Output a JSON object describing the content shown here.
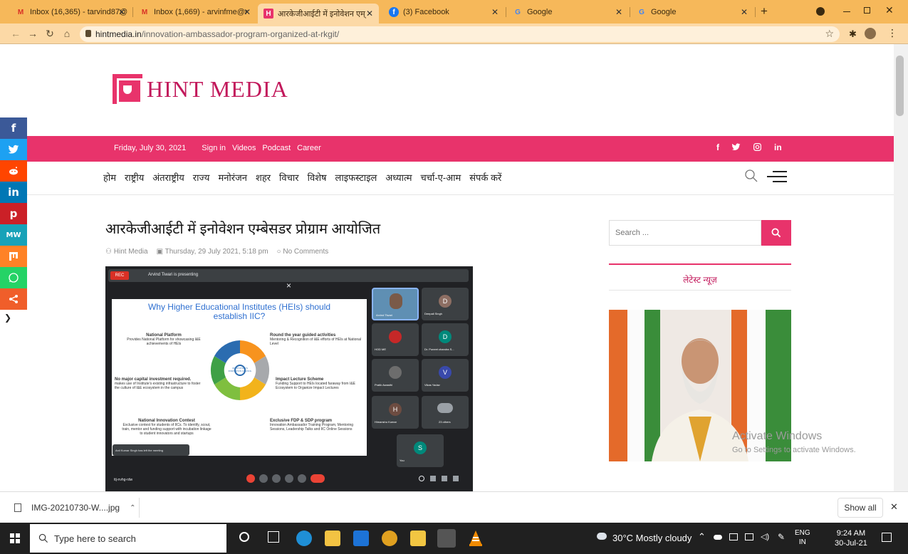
{
  "browser": {
    "tabs": [
      {
        "label": "Inbox (16,365) - tarvind87@",
        "icon": "gmail-icon"
      },
      {
        "label": "Inbox (1,669) - arvinfme@r",
        "icon": "gmail-icon"
      },
      {
        "label": "आरकेजीआईटी में इनोवेशन एम्",
        "icon": "hintmedia-icon",
        "active": true
      },
      {
        "label": "(3) Facebook",
        "icon": "facebook-icon"
      },
      {
        "label": "Google",
        "icon": "google-icon"
      },
      {
        "label": "Google",
        "icon": "google-icon"
      }
    ],
    "new_tab_symbol": "+",
    "url_host": "hintmedia.in",
    "url_path": "/innovation-ambassador-program-organized-at-rkgit/",
    "accent": "#f6b85a"
  },
  "site": {
    "logo_text": "HINT MEDIA",
    "brand_color": "#e8336b",
    "date": "Friday, July 30, 2021",
    "top_links": [
      "Sign in",
      "Videos",
      "Podcast",
      "Career"
    ],
    "social_top": [
      "f",
      "in"
    ],
    "menu": [
      "होम",
      "राष्ट्रीय",
      "अंतराष्ट्रीय",
      "राज्य",
      "मनोरंजन",
      "शहर",
      "विचार",
      "विशेष",
      "लाइफस्टाइल",
      "अध्यात्म",
      "चर्चा-ए-आम",
      "संपर्क करें"
    ]
  },
  "article": {
    "title": "आरकेजीआईटी में इनोवेशन एम्बेसडर प्रोग्राम आयोजित",
    "author": "Hint Media",
    "date": "Thursday, 29 July 2021, 5:18 pm",
    "comments": "No Comments"
  },
  "meeting": {
    "rec_label": "REC",
    "presenter_text": "Arvind Tiwari is presenting",
    "close_symbol": "×",
    "slide_title_line1": "Why Higher Educational Institutes (HEIs) should",
    "slide_title_line2": "establish IIC?",
    "slide_blocks": [
      {
        "heading": "National Platform",
        "body": "Provides National Platform for showcasing I&E achievements of HEIs"
      },
      {
        "heading": "Round the year guided activities",
        "body": "Mentoring & Recognition of I&E efforts of HEIs at National Level"
      },
      {
        "heading": "No major capital investment required.",
        "body": "makes use of Institute's existing infrastructure to foster the culture of I&E ecosystem in the campus"
      },
      {
        "heading": "Impact Lecture Scheme",
        "body": "Funding Support to HEIs located faraway from I&E Ecosystem to Organize Impact Lectures"
      },
      {
        "heading": "National Innovation Contest",
        "body": "Exclusive contest for students of IICs. To identify, scout, train, mentor and funding support with incubation linkage to student innovators and startups"
      },
      {
        "heading": "Exclusive FDP & SDP program",
        "body": "Innovation Ambassador Training Program, Mentoring Sessions, Leadership Talks and IIC Online Sessions"
      }
    ],
    "wheel_center": "INSTITUTION'S INNOVATION COUNCIL",
    "participants": [
      {
        "name": "Arvind Tiwari",
        "initial": "",
        "color": "#5f8fb3"
      },
      {
        "name": "Deepali Singh",
        "initial": "D",
        "color": "#8d6e63"
      },
      {
        "name": "HOD ME",
        "initial": "",
        "color": "#c62828"
      },
      {
        "name": "Dr. Puneet chandra S...",
        "initial": "D",
        "color": "#00897b"
      },
      {
        "name": "Pratik Awasthi",
        "initial": "",
        "color": "#6d6d6d"
      },
      {
        "name": "Vikas Yadav",
        "initial": "V",
        "color": "#3949ab"
      },
      {
        "name": "Himanshu Kumar",
        "initial": "H",
        "color": "#6d4c41"
      },
      {
        "name": "23 others",
        "initial": "",
        "color": "#5f6368"
      },
      {
        "name": "You",
        "initial": "S",
        "color": "#00897b"
      }
    ],
    "toast": "Anil Kumar Singh has left the meeting",
    "meeting_code": "ttj-nvhg-rdw"
  },
  "sidebar": {
    "search_placeholder": "Search ...",
    "latest_news": "लेटेस्ट न्यूज़"
  },
  "watermark": {
    "title": "Activate Windows",
    "subtitle": "Go to Settings to activate Windows."
  },
  "download": {
    "file": "IMG-20210730-W....jpg",
    "show_all": "Show all"
  },
  "taskbar": {
    "search_placeholder": "Type here to search",
    "weather": "30°C  Mostly cloudy",
    "lang_line1": "ENG",
    "lang_line2": "IN",
    "time": "9:24 AM",
    "date": "30-Jul-21"
  },
  "share_buttons": [
    {
      "name": "facebook",
      "glyph": "f",
      "color": "#3b5998"
    },
    {
      "name": "twitter",
      "glyph": "t",
      "color": "#1da1f2"
    },
    {
      "name": "reddit",
      "glyph": "r",
      "color": "#ff4500"
    },
    {
      "name": "linkedin",
      "glyph": "in",
      "color": "#0077b5"
    },
    {
      "name": "pinterest",
      "glyph": "p",
      "color": "#cb2027"
    },
    {
      "name": "mewe",
      "glyph": "MW",
      "color": "#17a2b8"
    },
    {
      "name": "mix",
      "glyph": "m",
      "color": "#ff8226"
    },
    {
      "name": "whatsapp",
      "glyph": "w",
      "color": "#25d366"
    },
    {
      "name": "share",
      "glyph": "<",
      "color": "#f05e2a"
    }
  ]
}
